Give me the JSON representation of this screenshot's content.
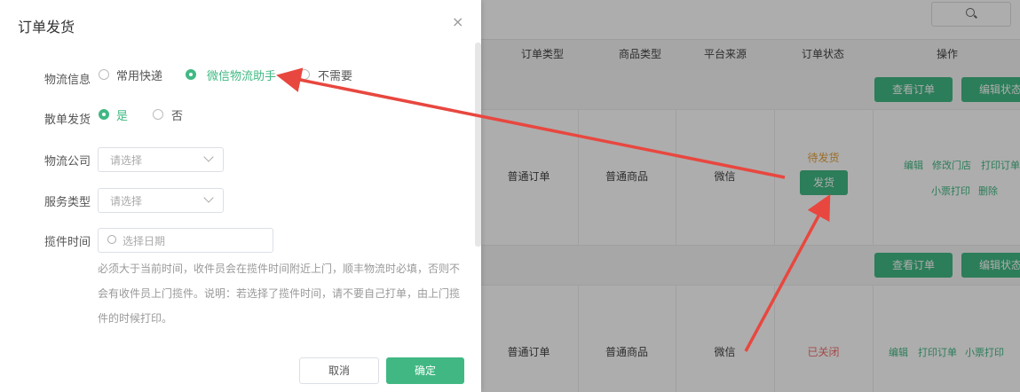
{
  "table": {
    "headers": [
      "订单类型",
      "商品类型",
      "平台来源",
      "订单状态",
      "操作"
    ],
    "group_buttons": {
      "view_order": "查看订单",
      "edit_status": "编辑状态"
    },
    "rows": [
      {
        "order_type": "普通订单",
        "goods_type": "普通商品",
        "platform": "微信",
        "status": "待发货",
        "ship_button": "发货",
        "actions": [
          "编辑",
          "修改门店",
          "打印订单",
          "小票打印",
          "删除"
        ]
      },
      {
        "order_type": "普通订单",
        "goods_type": "普通商品",
        "platform": "微信",
        "status": "已关闭",
        "actions": [
          "编辑",
          "打印订单",
          "小票打印"
        ]
      }
    ]
  },
  "dialog": {
    "title": "订单发货",
    "close": "×",
    "logistics_info": {
      "label": "物流信息",
      "options": [
        "常用快递",
        "微信物流助手",
        "不需要"
      ],
      "selected": "微信物流助手"
    },
    "single_ship": {
      "label": "散单发货",
      "options": [
        "是",
        "否"
      ],
      "selected": "是"
    },
    "company": {
      "label": "物流公司",
      "placeholder": "请选择"
    },
    "service_type": {
      "label": "服务类型",
      "placeholder": "请选择"
    },
    "pickup_time": {
      "label": "揽件时间",
      "placeholder": "选择日期"
    },
    "help_text": "必须大于当前时间，收件员会在揽件时间附近上门，顺丰物流时必填，否则不会有收件员上门揽件。说明：若选择了揽件时间，请不要自己打单，由上门揽件的时候打印。",
    "cancel": "取消",
    "confirm": "确定"
  },
  "colors": {
    "accent": "#41b883",
    "annotation": "#e8473f",
    "warning": "#e6a23c",
    "danger": "#f56c6c"
  },
  "icons": [
    "search-icon",
    "close-icon",
    "chevron-down-icon",
    "clock-icon"
  ]
}
